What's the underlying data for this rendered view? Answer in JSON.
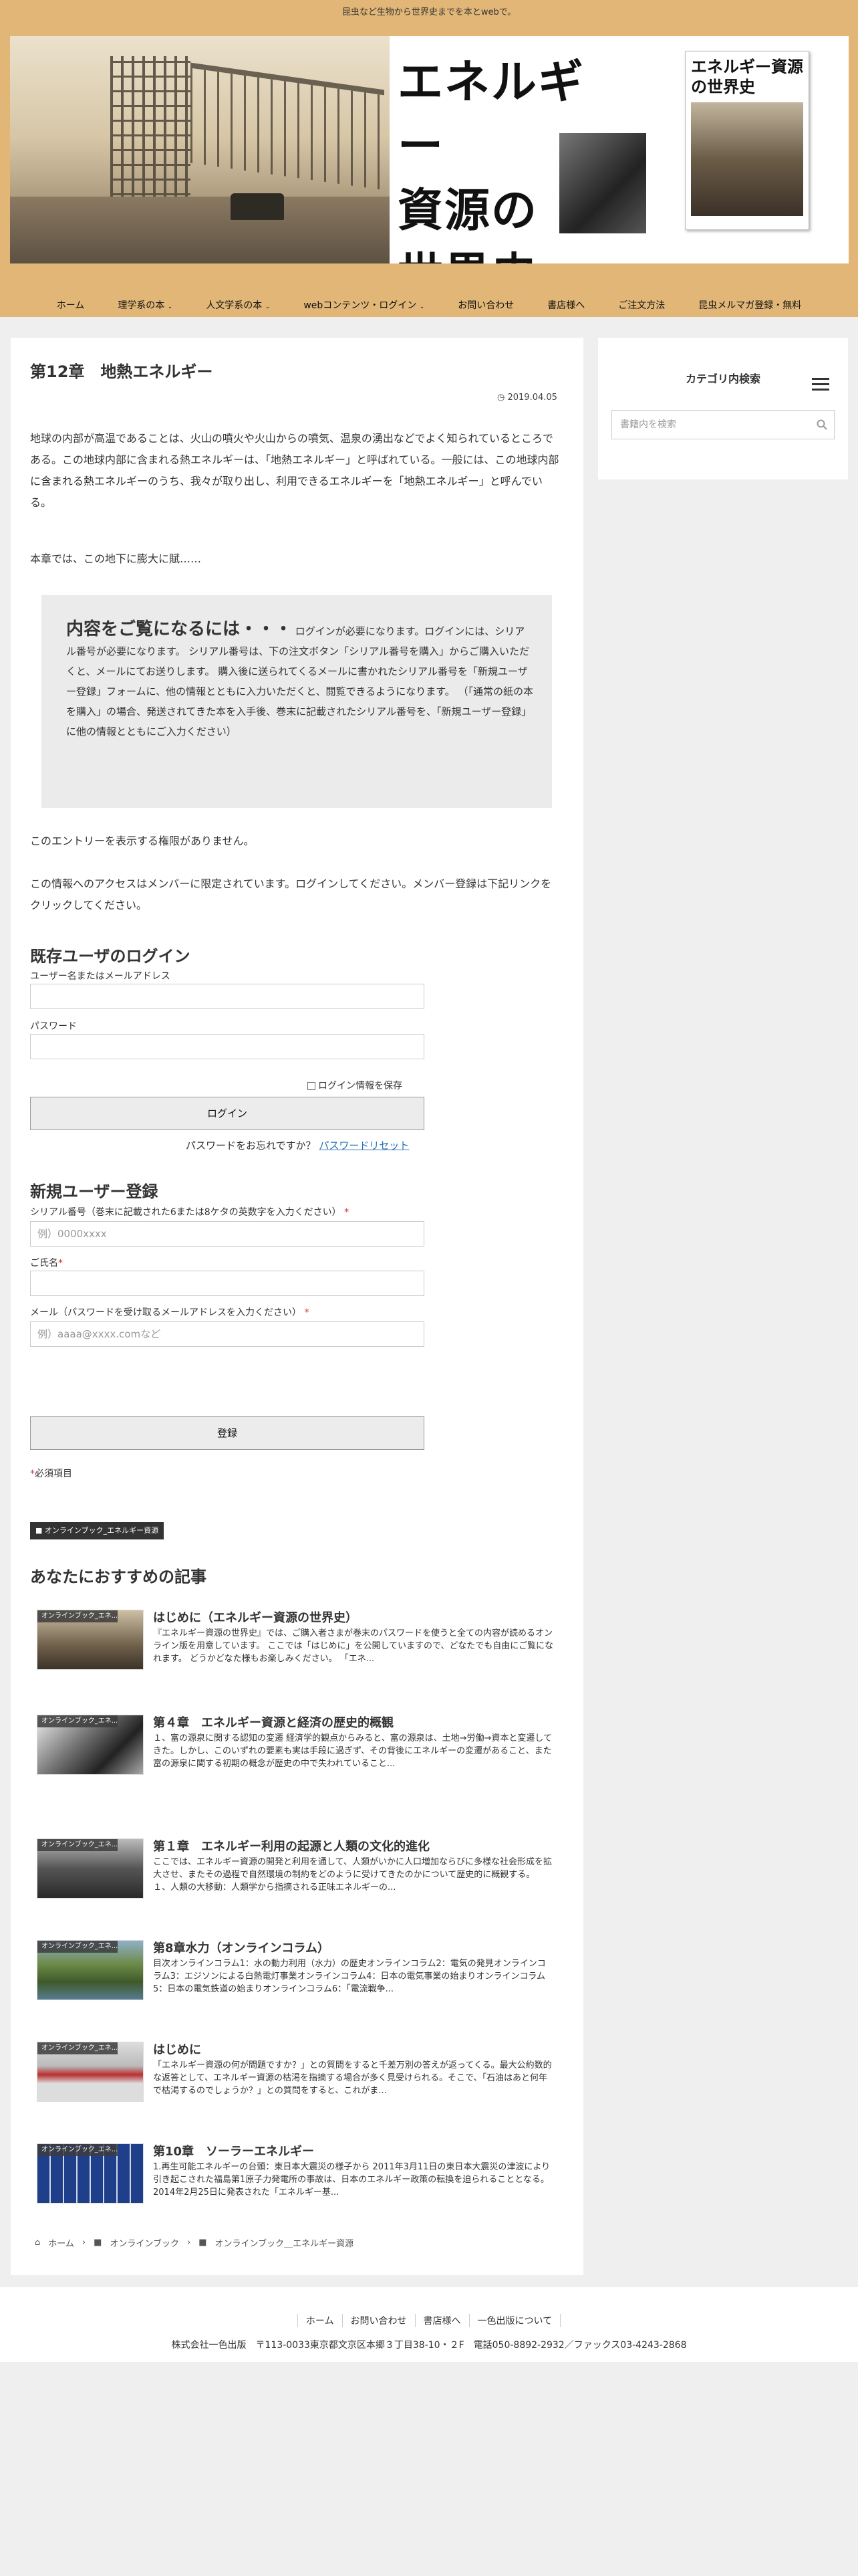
{
  "top_bar": {
    "tagline": "昆虫など生物から世界史までを本とwebで。"
  },
  "banner": {
    "title_line1": "エネルギー",
    "title_line2": "資源の",
    "title_line3": "世界史",
    "book_title": "エネルギー資源の世界史"
  },
  "nav": {
    "items": [
      "ホーム",
      "理学系の本",
      "人文学系の本",
      "webコンテンツ・ログイン",
      "お問い合わせ",
      "書店様へ",
      "ご注文方法",
      "昆虫メルマガ登録・無料"
    ]
  },
  "sidebar": {
    "title": "カテゴリ内検索",
    "search_placeholder": "書籍内を検索"
  },
  "article": {
    "title": "第12章　地熱エネルギー",
    "date": "2019.04.05",
    "intro": "地球の内部が高温であることは、火山の噴火や火山からの噴気、温泉の湧出などでよく知られているところである。この地球内部に含まれる熱エネルギーは、「地熱エネルギー」と呼ばれている。一般には、この地球内部に含まれる熱エネルギーのうち、我々が取り出し、利用できるエネルギーを「地熱エネルギー」と呼んでいる。",
    "p2": "本章では、この地下に膨大に賦……",
    "box_lead": "内容をご覧になるには・・・",
    "box_text": "ログインが必要になります。ログインには、シリアル番号が必要になります。 シリアル番号は、下の注文ボタン「シリアル番号を購入」からご購入いただくと、メールにてお送りします。 購入後に送られてくるメールに書かれたシリアル番号を「新規ユーザー登録」フォームに、他の情報とともに入力いただくと、閲覧できるようになります。 （「通常の紙の本を購入」の場合、発送されてきた本を入手後、巻末に記載されたシリアル番号を、「新規ユーザー登録」に他の情報とともにご入力ください）",
    "no_permission": "このエントリーを表示する権限がありません。",
    "access_note": "この情報へのアクセスはメンバーに限定されています。ログインしてください。メンバー登録は下記リンクをクリックしてください。"
  },
  "login": {
    "heading": "既存ユーザのログイン",
    "username_label": "ユーザー名またはメールアドレス",
    "password_label": "パスワード",
    "remember_label": "ログイン情報を保存",
    "login_button": "ログイン",
    "forgot_text": "パスワードをお忘れですか？",
    "reset_link": "パスワードリセット"
  },
  "register": {
    "heading": "新規ユーザー登録",
    "serial_label": "シリアル番号（巻末に記載された6または8ケタの英数字を入力ください）",
    "serial_placeholder": "例）0000xxxx",
    "name_label": "ご氏名",
    "email_label": "メール（パスワードを受け取るメールアドレスを入力ください）",
    "email_placeholder": "例）aaaa@xxxx.comなど",
    "submit_button": "登録",
    "required_note": "必須項目",
    "asterisk": "*"
  },
  "category_tag": "オンラインブック_エネルギー資源",
  "recommended": {
    "heading": "あなたにおすすめの記事",
    "items": [
      {
        "thumb_label": "オンラインブック_エネ...",
        "title": "はじめに（エネルギー資源の世界史）",
        "text": "『エネルギー資源の世界史』では、ご購入者さまが巻末のパスワードを使うと全ての内容が読めるオンライン版を用意しています。 ここでは「はじめに」を公開していますので、どなたでも自由にご覧になれます。 どうかどなた様もお楽しみください。 「エネ..."
      },
      {
        "thumb_label": "オンラインブック_エネ...",
        "title": "第４章　エネルギー資源と経済の歴史的概観",
        "text": "１、富の源泉に関する認知の変遷 経済学的観点からみると、富の源泉は、土地→労働→資本と変遷してきた。しかし、このいずれの要素も実は手段に過ぎず、その背後にエネルギーの変遷があること、また富の源泉に関する初期の概念が歴史の中で失われていること..."
      },
      {
        "thumb_label": "オンラインブック_エネ...",
        "title": "第１章　エネルギー利用の起源と人類の文化的進化",
        "text": "ここでは、エネルギー資源の開発と利用を通して、人類がいかに人口増加ならびに多様な社会形成を拡大させ、またその過程で自然環境の制約をどのように受けてきたのかについて歴史的に概観する。 １、人類の大移動：人類学から指摘される正味エネルギーの..."
      },
      {
        "thumb_label": "オンラインブック_エネ...",
        "title": "第8章水力（オンラインコラム）",
        "text": "目次オンラインコラム1：水の動力利用（水力）の歴史オンラインコラム2：電気の発見オンラインコラム3：エジソンによる白熱電灯事業オンラインコラム4：日本の電気事業の始まりオンラインコラム5：日本の電気鉄道の始まりオンラインコラム6：「電流戦争..."
      },
      {
        "thumb_label": "オンラインブック_エネ...",
        "title": "はじめに",
        "text": "「エネルギー資源の何が問題ですか？」との質問をすると千差万別の答えが返ってくる。最大公約数的な返答として、エネルギー資源の枯渇を指摘する場合が多く見受けられる。そこで、「石油はあと何年で枯渇するのでしょうか？」との質問をすると、これがま..."
      },
      {
        "thumb_label": "オンラインブック_エネ...",
        "title": "第10章　ソーラーエネルギー",
        "text": "1.再生可能エネルギーの台頭：東日本大震災の様子から 2011年3月11日の東日本大震災の津波により引き起こされた福島第1原子力発電所の事故は、日本のエネルギー政策の転換を迫られることとなる。2014年2月25日に発表された「エネルギー基..."
      }
    ]
  },
  "breadcrumb": [
    "ホーム",
    "オンラインブック",
    "オンラインブック＿エネルギー資源"
  ],
  "footer": {
    "links": [
      "ホーム",
      "お問い合わせ",
      "書店様へ",
      "一色出版について"
    ],
    "company": "株式会社一色出版　〒113-0033東京都文京区本郷３丁目38-10・２F　電話050-8892-2932／ファックス03-4243-2868"
  },
  "colors": {
    "header": "#e1b676",
    "page_bg": "#efeff0",
    "link": "#2872b8",
    "required": "#d33"
  }
}
